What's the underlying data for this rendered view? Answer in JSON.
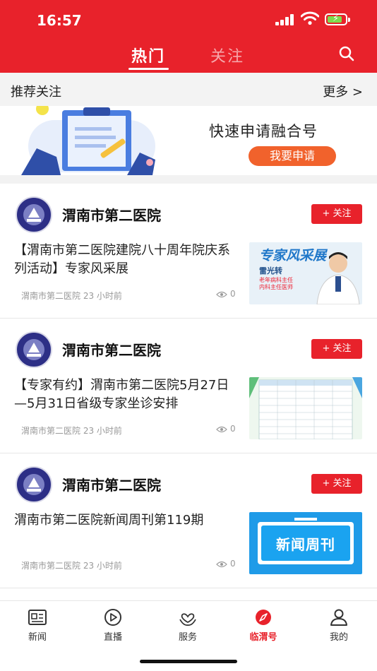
{
  "status": {
    "time": "16:57"
  },
  "header": {
    "tabs": [
      {
        "label": "热门",
        "active": true
      },
      {
        "label": "关注",
        "active": false
      }
    ],
    "search_icon": "search-icon",
    "accent": "#e8222b"
  },
  "recommend": {
    "title": "推荐关注",
    "more": "更多 >"
  },
  "banner": {
    "title": "快速申请融合号",
    "button": "我要申请"
  },
  "cards": [
    {
      "org": "渭南市第二医院",
      "follow": "+ 关注",
      "headline": "【渭南市第二医院建院八十周年院庆系列活动】专家风采展",
      "source": "渭南市第二医院  23 小时前",
      "views": "0",
      "thumb": {
        "title": "专家风采展",
        "name": "雷光转",
        "role1": "老年病科主任",
        "role2": "内科主任医师"
      }
    },
    {
      "org": "渭南市第二医院",
      "follow": "+ 关注",
      "headline": "【专家有约】渭南市第二医院5月27日—5月31日省级专家坐诊安排",
      "source": "渭南市第二医院  23 小时前",
      "views": "0"
    },
    {
      "org": "渭南市第二医院",
      "follow": "+ 关注",
      "headline": "渭南市第二医院新闻周刊第119期",
      "source": "渭南市第二医院  23 小时前",
      "views": "0",
      "thumb": {
        "title": "新闻周刊"
      }
    }
  ],
  "tabbar": [
    {
      "label": "新闻",
      "icon": "news-icon"
    },
    {
      "label": "直播",
      "icon": "play-icon"
    },
    {
      "label": "服务",
      "icon": "service-icon"
    },
    {
      "label": "临渭号",
      "icon": "compass-icon",
      "active": true
    },
    {
      "label": "我的",
      "icon": "person-icon"
    }
  ]
}
